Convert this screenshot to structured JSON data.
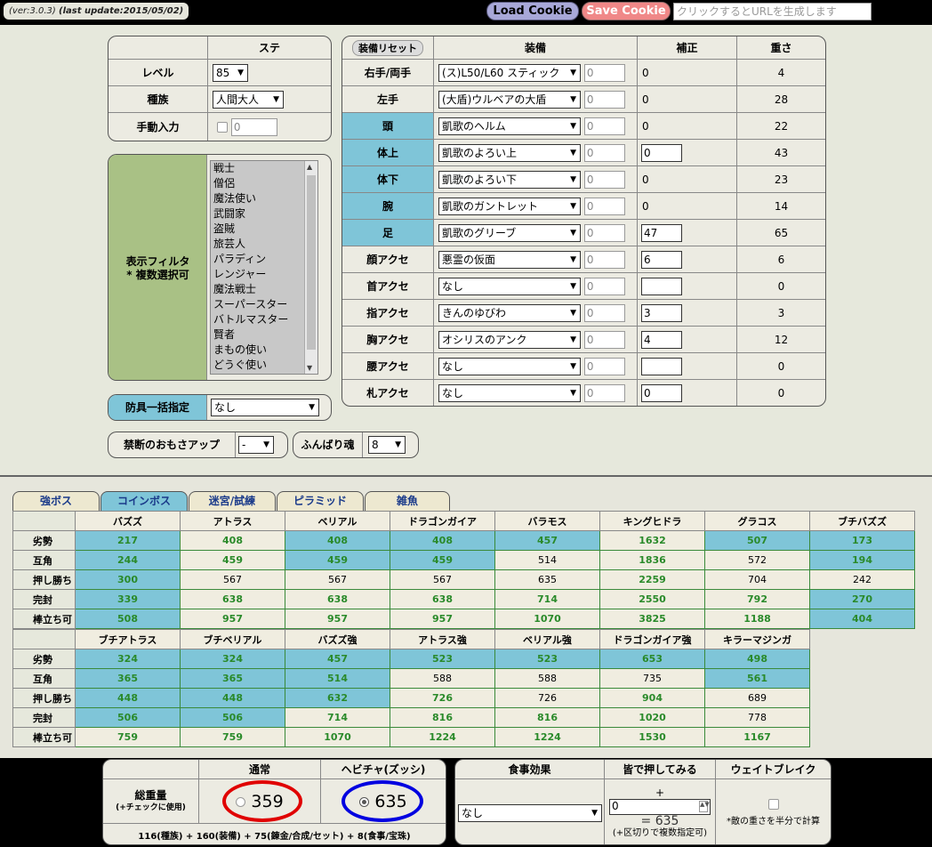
{
  "header": {
    "version": "(ver:3.0.3)",
    "last_update": "(last update:2015/05/02)",
    "load_cookie": "Load Cookie",
    "save_cookie": "Save Cookie",
    "url_placeholder": "クリックするとURLを生成します"
  },
  "stats": {
    "col_header": "ステ",
    "level_label": "レベル",
    "level_value": "85",
    "race_label": "種族",
    "race_value": "人間大人",
    "manual_label": "手動入力",
    "manual_value": "0"
  },
  "filter": {
    "label1": "表示フィルタ",
    "label2": "* 複数選択可",
    "items": [
      "戦士",
      "僧侶",
      "魔法使い",
      "武闘家",
      "盗賊",
      "旅芸人",
      "パラディン",
      "レンジャー",
      "魔法戦士",
      "スーパースター",
      "バトルマスター",
      "賢者",
      "まもの使い",
      "どうぐ使い"
    ]
  },
  "armor_bulk": {
    "label": "防具一括指定",
    "value": "なし"
  },
  "forbidden": {
    "label": "禁断のおもさアップ",
    "value": "-"
  },
  "funbari": {
    "label": "ふんばり魂",
    "value": "8"
  },
  "equip": {
    "reset": "装備リセット",
    "h_equip": "装備",
    "h_bonus": "補正",
    "h_weight": "重さ",
    "rows": [
      {
        "slot": "右手/両手",
        "item": "(ス)L50/L60 スティック",
        "n": "0",
        "bonus": "0",
        "bbox": false,
        "weight": "4",
        "hl": false
      },
      {
        "slot": "左手",
        "item": "(大盾)ウルベアの大盾",
        "n": "0",
        "bonus": "0",
        "bbox": false,
        "weight": "28",
        "hl": false
      },
      {
        "slot": "頭",
        "item": "凱歌のヘルム",
        "n": "0",
        "bonus": "0",
        "bbox": false,
        "weight": "22",
        "hl": true
      },
      {
        "slot": "体上",
        "item": "凱歌のよろい上",
        "n": "0",
        "bonus": "0",
        "bbox": true,
        "weight": "43",
        "hl": true
      },
      {
        "slot": "体下",
        "item": "凱歌のよろい下",
        "n": "0",
        "bonus": "0",
        "bbox": false,
        "weight": "23",
        "hl": true
      },
      {
        "slot": "腕",
        "item": "凱歌のガントレット",
        "n": "0",
        "bonus": "0",
        "bbox": false,
        "weight": "14",
        "hl": true
      },
      {
        "slot": "足",
        "item": "凱歌のグリーブ",
        "n": "0",
        "bonus": "47",
        "bbox": true,
        "weight": "65",
        "hl": true
      },
      {
        "slot": "顔アクセ",
        "item": "悪霊の仮面",
        "n": "0",
        "bonus": "6",
        "bbox": true,
        "weight": "6",
        "hl": false
      },
      {
        "slot": "首アクセ",
        "item": "なし",
        "n": "0",
        "bonus": "",
        "bbox": true,
        "weight": "0",
        "hl": false
      },
      {
        "slot": "指アクセ",
        "item": "きんのゆびわ",
        "n": "0",
        "bonus": "3",
        "bbox": true,
        "weight": "3",
        "hl": false
      },
      {
        "slot": "胸アクセ",
        "item": "オシリスのアンク",
        "n": "0",
        "bonus": "4",
        "bbox": true,
        "weight": "12",
        "hl": false
      },
      {
        "slot": "腰アクセ",
        "item": "なし",
        "n": "0",
        "bonus": "",
        "bbox": true,
        "weight": "0",
        "hl": false
      },
      {
        "slot": "札アクセ",
        "item": "なし",
        "n": "0",
        "bonus": "0",
        "bbox": true,
        "weight": "0",
        "hl": false
      }
    ]
  },
  "tabs": [
    "強ボス",
    "コインボス",
    "迷宮/試練",
    "ピラミッド",
    "雑魚"
  ],
  "boss_rows": [
    "劣勢",
    "互角",
    "押し勝ち",
    "完封",
    "棒立ち可"
  ],
  "boss_table1": {
    "headers": [
      "バズズ",
      "アトラス",
      "ベリアル",
      "ドラゴンガイア",
      "バラモス",
      "キングヒドラ",
      "グラコス",
      "ブチバズズ"
    ],
    "cells": [
      [
        [
          "217",
          "b"
        ],
        [
          "408",
          "c"
        ],
        [
          "408",
          "b"
        ],
        [
          "408",
          "b"
        ],
        [
          "457",
          "b"
        ],
        [
          "1632",
          "c"
        ],
        [
          "507",
          "b"
        ],
        [
          "173",
          "b"
        ]
      ],
      [
        [
          "244",
          "b"
        ],
        [
          "459",
          "c"
        ],
        [
          "459",
          "b"
        ],
        [
          "459",
          "b"
        ],
        [
          "514",
          "n"
        ],
        [
          "1836",
          "c"
        ],
        [
          "572",
          "n"
        ],
        [
          "194",
          "b"
        ]
      ],
      [
        [
          "300",
          "b"
        ],
        [
          "567",
          "n"
        ],
        [
          "567",
          "n"
        ],
        [
          "567",
          "n"
        ],
        [
          "635",
          "n"
        ],
        [
          "2259",
          "c"
        ],
        [
          "704",
          "n"
        ],
        [
          "242",
          "n"
        ]
      ],
      [
        [
          "339",
          "b"
        ],
        [
          "638",
          "c"
        ],
        [
          "638",
          "c"
        ],
        [
          "638",
          "c"
        ],
        [
          "714",
          "c"
        ],
        [
          "2550",
          "c"
        ],
        [
          "792",
          "c"
        ],
        [
          "270",
          "b"
        ]
      ],
      [
        [
          "508",
          "b"
        ],
        [
          "957",
          "c"
        ],
        [
          "957",
          "c"
        ],
        [
          "957",
          "c"
        ],
        [
          "1070",
          "c"
        ],
        [
          "3825",
          "c"
        ],
        [
          "1188",
          "c"
        ],
        [
          "404",
          "b"
        ]
      ]
    ]
  },
  "boss_table2": {
    "headers": [
      "ブチアトラス",
      "ブチベリアル",
      "バズズ強",
      "アトラス強",
      "ベリアル強",
      "ドラゴンガイア強",
      "キラーマジンガ"
    ],
    "cells": [
      [
        [
          "324",
          "b"
        ],
        [
          "324",
          "b"
        ],
        [
          "457",
          "b"
        ],
        [
          "523",
          "b"
        ],
        [
          "523",
          "b"
        ],
        [
          "653",
          "b"
        ],
        [
          "498",
          "b"
        ]
      ],
      [
        [
          "365",
          "b"
        ],
        [
          "365",
          "b"
        ],
        [
          "514",
          "b"
        ],
        [
          "588",
          "n"
        ],
        [
          "588",
          "n"
        ],
        [
          "735",
          "n"
        ],
        [
          "561",
          "b"
        ]
      ],
      [
        [
          "448",
          "b"
        ],
        [
          "448",
          "b"
        ],
        [
          "632",
          "b"
        ],
        [
          "726",
          "c"
        ],
        [
          "726",
          "n"
        ],
        [
          "904",
          "c"
        ],
        [
          "689",
          "n"
        ]
      ],
      [
        [
          "506",
          "b"
        ],
        [
          "506",
          "b"
        ],
        [
          "714",
          "c"
        ],
        [
          "816",
          "c"
        ],
        [
          "816",
          "c"
        ],
        [
          "1020",
          "c"
        ],
        [
          "778",
          "n"
        ]
      ],
      [
        [
          "759",
          "c"
        ],
        [
          "759",
          "c"
        ],
        [
          "1070",
          "c"
        ],
        [
          "1224",
          "c"
        ],
        [
          "1224",
          "c"
        ],
        [
          "1530",
          "c"
        ],
        [
          "1167",
          "c"
        ]
      ]
    ]
  },
  "total": {
    "label1": "総重量",
    "label2": "(+チェックに使用)",
    "normal_h": "通常",
    "heavy_h": "ヘビチャ(ズッシ)",
    "normal": "359",
    "heavy": "635",
    "formula": "116(種族) + 160(装備) + 75(錬金/合成/セット) + 8(食事/宝珠)"
  },
  "food": {
    "h_food": "食事効果",
    "h_push": "皆で押してみる",
    "h_wb": "ウェイトブレイク",
    "food_value": "なし",
    "plus": "+",
    "push_value": "0",
    "result": "= 635",
    "note": "(+区切りで複数指定可)",
    "wb_note": "*敵の重さを半分で計算"
  },
  "colors": {
    "red_ring": "#e00000",
    "blue_ring": "#0000e0",
    "accent_blue": "#7fc5d8",
    "accent_green": "#a9c185"
  }
}
